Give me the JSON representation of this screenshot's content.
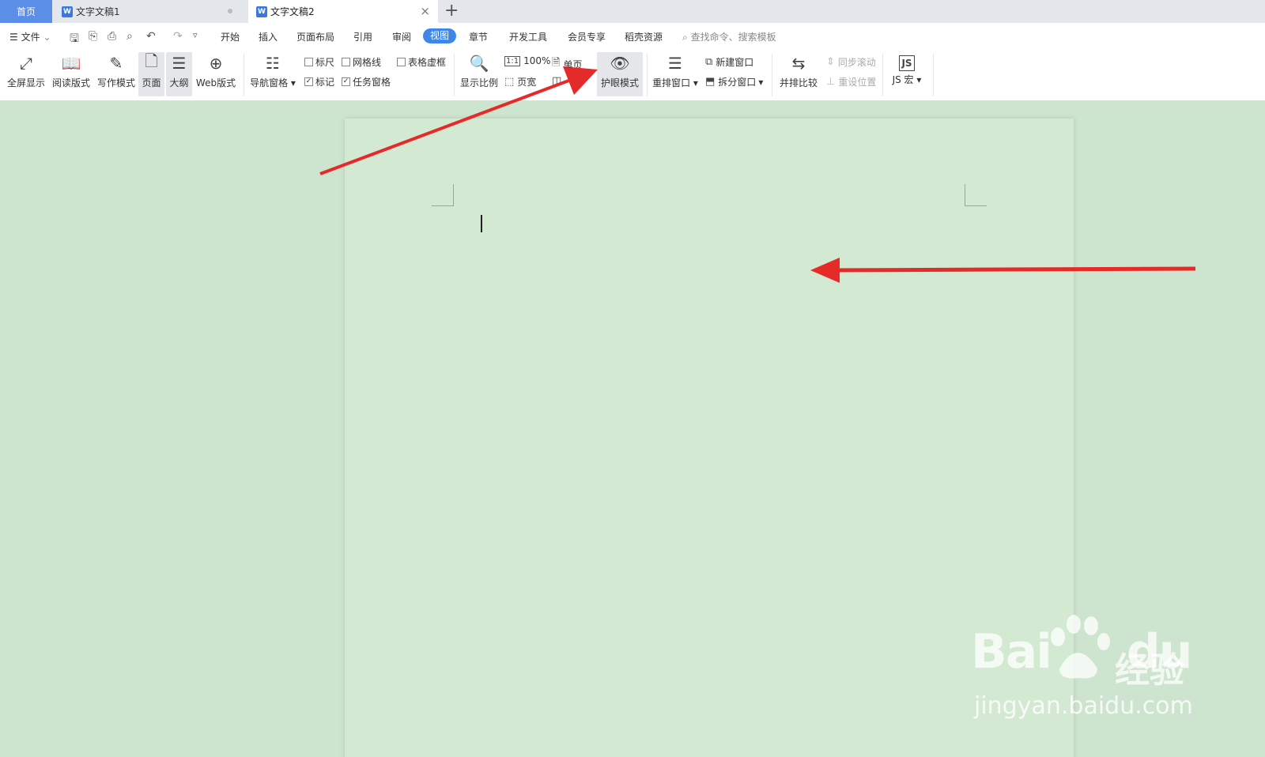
{
  "tabs": {
    "home": "首页",
    "doc1": "文字文稿1",
    "doc2": "文字文稿2",
    "wps_icon": "W",
    "add": "+",
    "close": "×"
  },
  "menu": {
    "file": "文件",
    "items": [
      "开始",
      "插入",
      "页面布局",
      "引用",
      "审阅",
      "视图",
      "章节",
      "开发工具",
      "会员专享",
      "稻壳资源"
    ],
    "active": "视图",
    "search_placeholder": "查找命令、搜索模板"
  },
  "ribbon": {
    "fullscreen": "全屏显示",
    "reading": "阅读版式",
    "writing": "写作模式",
    "page": "页面",
    "outline": "大纲",
    "web": "Web版式",
    "nav_pane": "导航窗格",
    "ruler": "标尺",
    "gridlines": "网格线",
    "table_gridlines": "表格虚框",
    "markup": "标记",
    "task_pane": "任务窗格",
    "zoom": "显示比例",
    "zoom_100": "100%",
    "page_width": "页宽",
    "single_page": "单页",
    "eye_mode": "护眼模式",
    "arrange": "重排窗口",
    "new_window": "新建窗口",
    "split": "拆分窗口",
    "side_by_side": "并排比较",
    "sync_scroll": "同步滚动",
    "reset_pos": "重设位置",
    "js_macro": "JS 宏",
    "checked": {
      "ruler": false,
      "gridlines": false,
      "table_gridlines": false,
      "markup": true,
      "task_pane": true
    }
  },
  "watermark": {
    "brand": "Bai",
    "brand2": "du",
    "cn": "经验",
    "url": "jingyan.baidu.com"
  },
  "colors": {
    "accent": "#3d87e8",
    "eye_bg": "#cde4cf",
    "arrow": "#e52a2a"
  }
}
